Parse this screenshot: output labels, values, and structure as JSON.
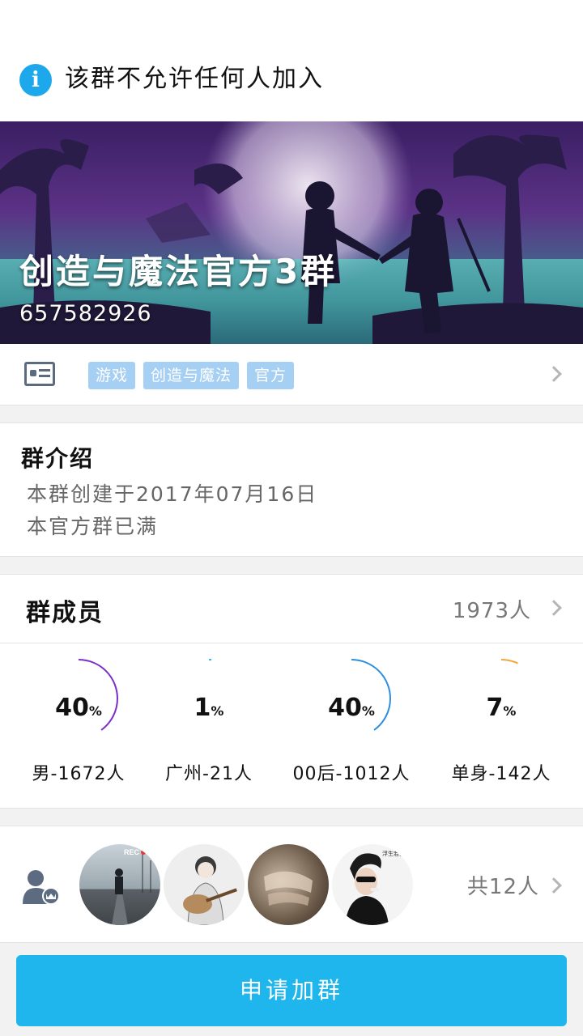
{
  "notice": {
    "text": "该群不允许任何人加入",
    "icon": "info-icon"
  },
  "banner": {
    "group_name": "创造与魔法官方3群",
    "group_id": "657582926"
  },
  "tags": [
    "游戏",
    "创造与魔法",
    "官方"
  ],
  "intro": {
    "title": "群介绍",
    "lines": [
      "本群创建于2017年07月16日",
      "本官方群已满"
    ]
  },
  "members": {
    "title": "群成员",
    "count": "1973人",
    "stats": [
      {
        "percent": "40",
        "unit": "%",
        "label": "男-1672人",
        "color": "#7b2fc9",
        "fraction": 0.4
      },
      {
        "percent": "1",
        "unit": "%",
        "label": "广州-21人",
        "color": "#2fb4e8",
        "fraction": 0.01
      },
      {
        "percent": "40",
        "unit": "%",
        "label": "00后-1012人",
        "color": "#2a8fe0",
        "fraction": 0.4
      },
      {
        "percent": "7",
        "unit": "%",
        "label": "单身-142人",
        "color": "#f4a43a",
        "fraction": 0.07
      }
    ]
  },
  "avatars": {
    "total": "共12人",
    "badges": [
      "REC"
    ]
  },
  "apply_button": "申请加群",
  "colors": {
    "accent": "#1eb6ec",
    "tag_bg": "#a5cff3"
  }
}
